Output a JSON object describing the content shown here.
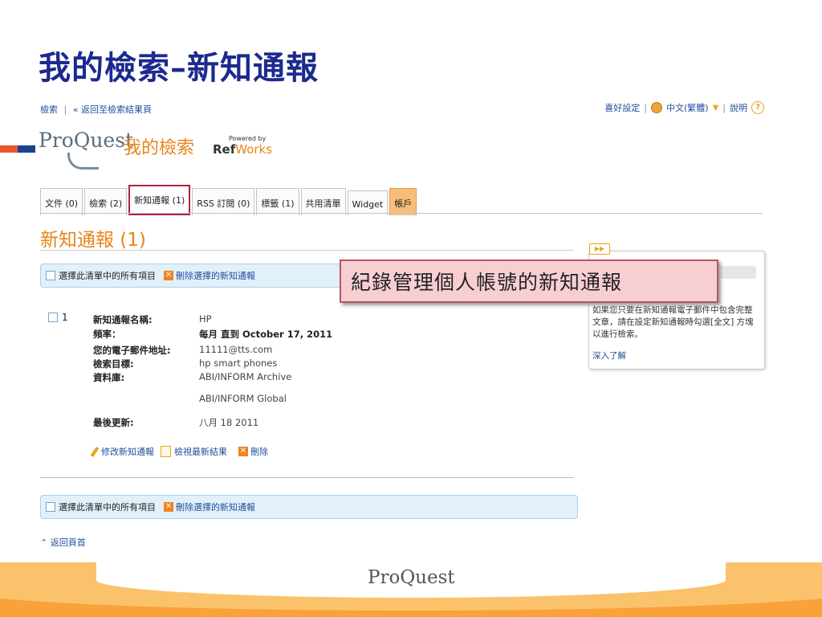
{
  "slide_title": "我的檢索–新知通報",
  "topnav": {
    "search": "檢索",
    "back": "« 返回至檢索結果頁"
  },
  "toprght": {
    "prefs": "喜好設定",
    "lang": "中文(繁體)",
    "help": "說明"
  },
  "brand": {
    "logo": "ProQuest",
    "my_search": "我的檢索",
    "powered_by": "Powered by",
    "ref": "Ref",
    "works": "Works"
  },
  "tabs": [
    {
      "label": "文件 (0)"
    },
    {
      "label": "檢索 (2)"
    },
    {
      "label": "新知通報 (1)"
    },
    {
      "label": "RSS 訂閱 (0)"
    },
    {
      "label": "標籤 (1)"
    },
    {
      "label": "共用清單"
    },
    {
      "label": "Widget"
    },
    {
      "label": "帳戶"
    }
  ],
  "section_title": "新知通報 (1)",
  "select_all": "選擇此清單中的所有項目",
  "delete_selected": "刪除選擇的新知通報",
  "record": {
    "number": "1",
    "name_label": "新知通報名稱:",
    "name_value": "HP",
    "freq_label": "頻率：",
    "freq_value": "每月 直到 October 17, 2011",
    "email_label": "您的電子郵件地址:",
    "email_value": "11111@tts.com",
    "target_label": "檢索目標:",
    "target_value": "hp smart phones",
    "db_label": "資料庫:",
    "db_value_1": "ABI/INFORM Archive",
    "db_value_2": "ABI/INFORM Global",
    "updated_label": "最後更新:",
    "updated_value": "八月 18 2011"
  },
  "actions": {
    "edit": "修改新知通報",
    "view": "檢視最新結果",
    "delete": "刪除"
  },
  "back_top": "返回頁首",
  "sidebar": {
    "text": "如果您只要在新知通報電子郵件中包含完整文章，請在設定新知通報時勾選[全文] 方塊以進行檢索。",
    "more": "深入了解"
  },
  "callout": "紀錄管理個人帳號的新知通報",
  "footer_logo": "ProQuest"
}
